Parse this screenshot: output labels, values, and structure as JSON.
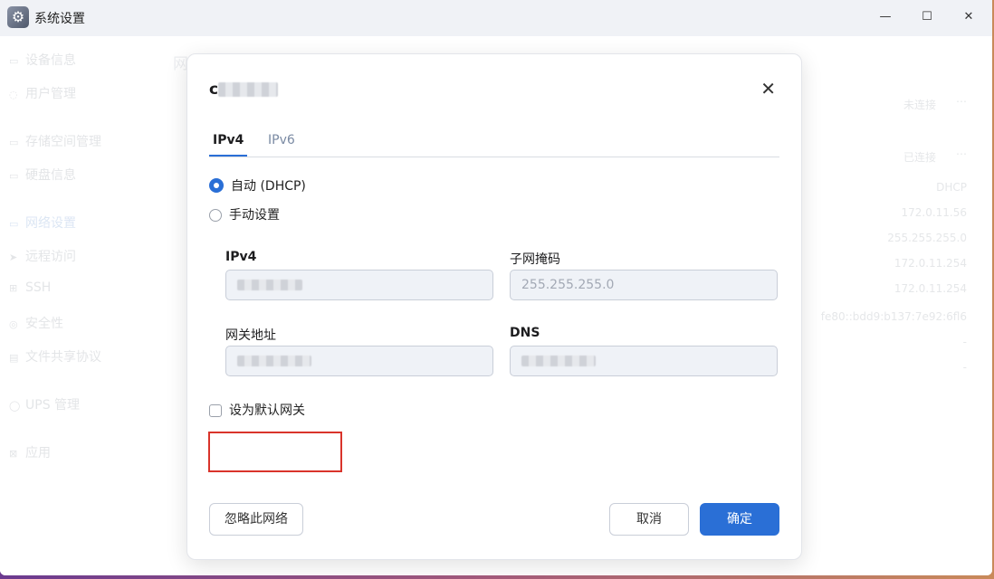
{
  "window": {
    "title": "系统设置",
    "controls": {
      "minimize": "—",
      "maximize": "☐",
      "close": "✕"
    }
  },
  "background": {
    "sidebar": [
      {
        "label": "设备信息",
        "icon": "device-icon"
      },
      {
        "label": "用户管理",
        "icon": "user-icon"
      },
      {
        "label": "存储空间管理",
        "icon": "storage-icon"
      },
      {
        "label": "硬盘信息",
        "icon": "disk-icon"
      },
      {
        "label": "网络设置",
        "icon": "network-icon"
      },
      {
        "label": "远程访问",
        "icon": "remote-icon"
      },
      {
        "label": "SSH",
        "icon": "ssh-icon"
      },
      {
        "label": "安全性",
        "icon": "security-icon"
      },
      {
        "label": "文件共享协议",
        "icon": "share-icon"
      },
      {
        "label": "UPS 管理",
        "icon": "ups-icon"
      },
      {
        "label": "应用",
        "icon": "apps-icon"
      }
    ],
    "header_partial": "网",
    "right_values": [
      "未连接",
      "已连接",
      "DHCP",
      "172.0.11.56",
      "255.255.255.0",
      "172.0.11.254",
      "172.0.11.254",
      "fe80::bdd9:b137:7e92:6fl6",
      "-",
      "-"
    ],
    "more_icon": "…"
  },
  "dialog": {
    "title_prefix": "c",
    "close_icon": "✕",
    "tabs": [
      {
        "label": "IPv4",
        "active": true
      },
      {
        "label": "IPv6",
        "active": false
      }
    ],
    "mode_options": [
      {
        "label": "自动 (DHCP)",
        "selected": true
      },
      {
        "label": "手动设置",
        "selected": false
      }
    ],
    "fields": {
      "ipv4": {
        "label": "IPv4",
        "value": ""
      },
      "subnet_mask": {
        "label": "子网掩码",
        "value": "255.255.255.0"
      },
      "gateway": {
        "label": "网关地址",
        "value": ""
      },
      "dns": {
        "label": "DNS",
        "value": ""
      }
    },
    "default_gateway_label": "设为默认网关",
    "buttons": {
      "ignore": "忽略此网络",
      "cancel": "取消",
      "confirm": "确定"
    }
  }
}
